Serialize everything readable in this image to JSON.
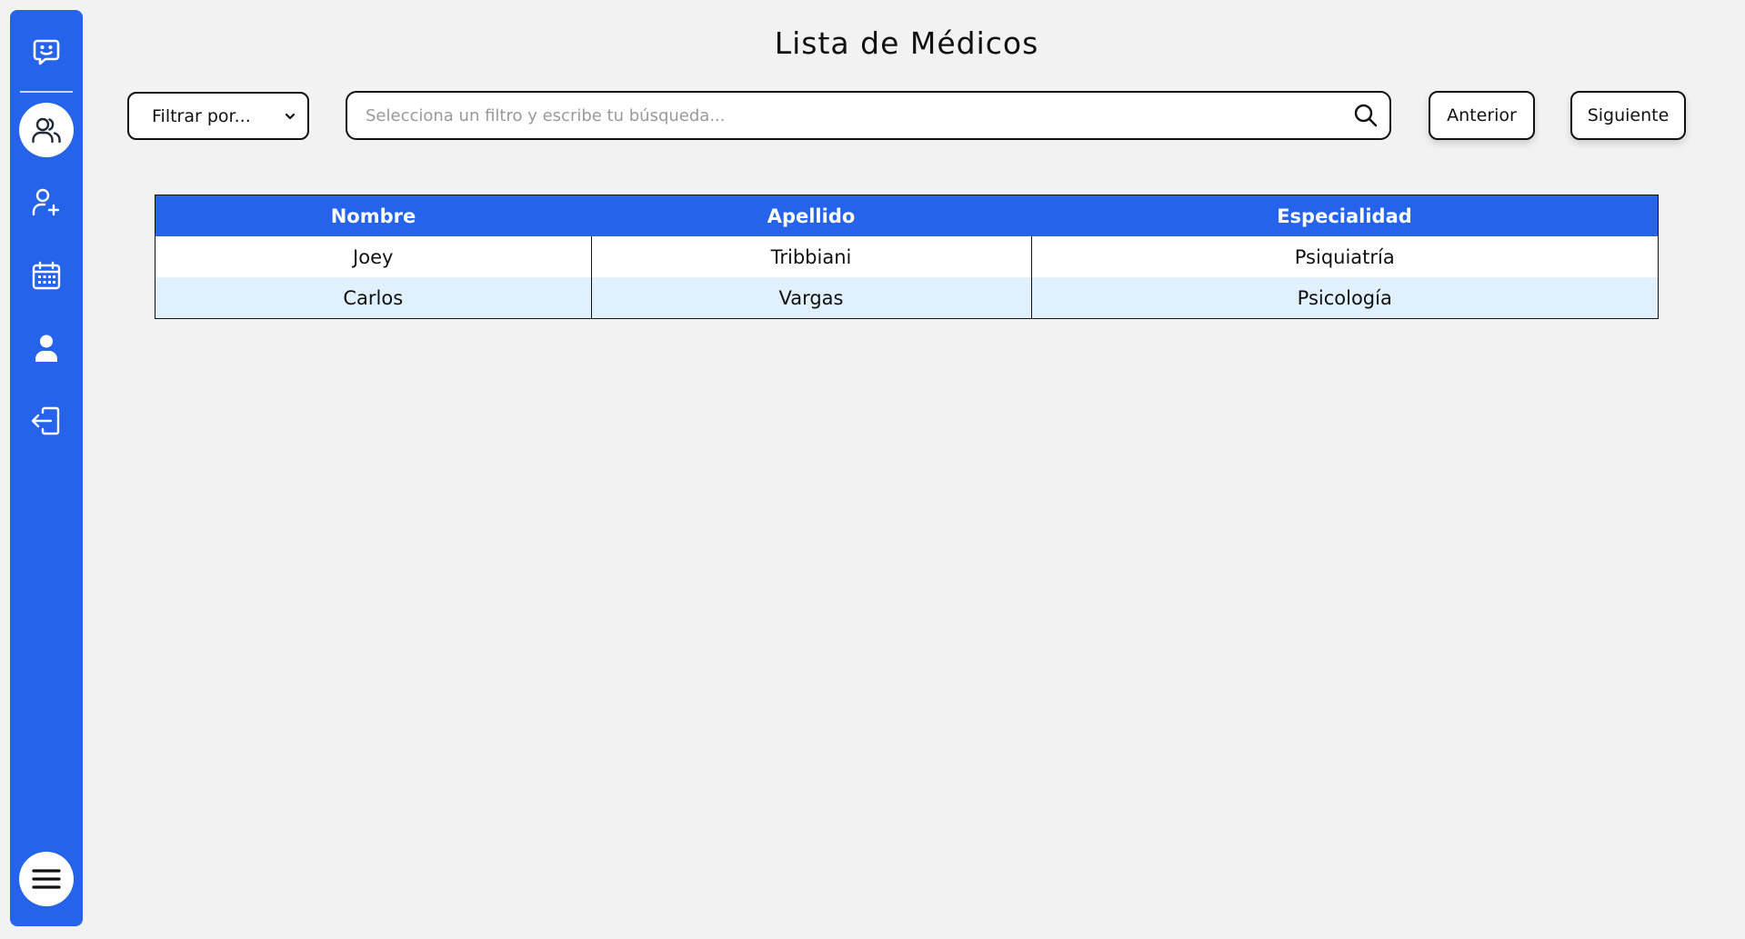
{
  "page": {
    "title": "Lista de Médicos"
  },
  "toolbar": {
    "filter": {
      "selected": "Filtrar por..."
    },
    "search": {
      "placeholder": "Selecciona un filtro y escribe tu búsqueda...",
      "value": ""
    },
    "prev_label": "Anterior",
    "next_label": "Siguiente"
  },
  "sidebar": {
    "items": [
      {
        "icon": "chat-bot-icon",
        "active": false
      },
      {
        "icon": "users-icon",
        "active": true
      },
      {
        "icon": "add-user-icon",
        "active": false
      },
      {
        "icon": "calendar-icon",
        "active": false
      },
      {
        "icon": "profile-icon",
        "active": false
      },
      {
        "icon": "logout-icon",
        "active": false
      }
    ],
    "menu_icon": "hamburger-menu-icon"
  },
  "table": {
    "headers": [
      "Nombre",
      "Apellido",
      "Especialidad"
    ],
    "rows": [
      [
        "Joey",
        "Tribbiani",
        "Psiquiatría"
      ],
      [
        "Carlos",
        "Vargas",
        "Psicología"
      ]
    ]
  },
  "colors": {
    "accent": "#2563eb",
    "row_alt": "#e0f0fd",
    "background": "#f2f2f2"
  }
}
